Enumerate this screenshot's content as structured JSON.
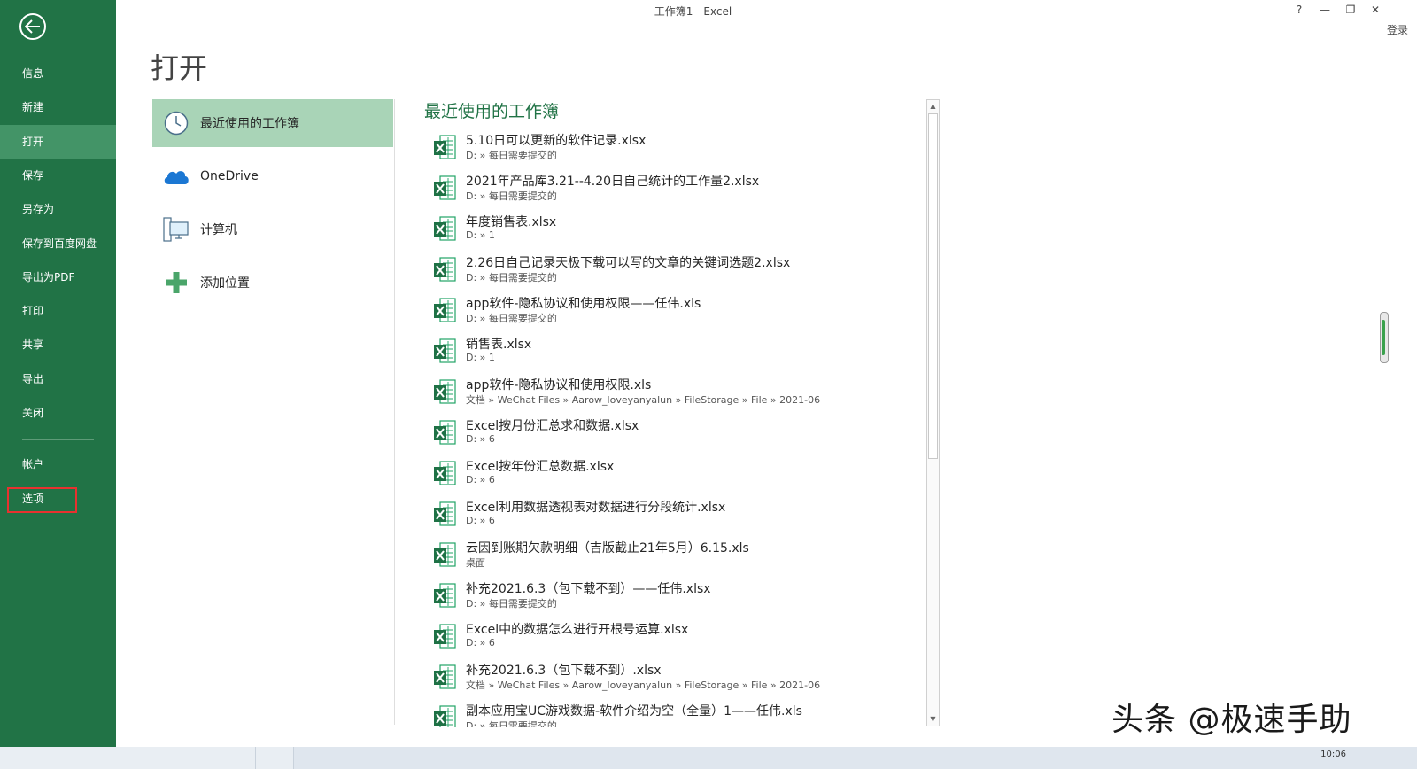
{
  "window": {
    "title": "工作簿1 - Excel",
    "help": "?",
    "minimize": "—",
    "restore": "❐",
    "close": "✕",
    "login": "登录"
  },
  "nav": {
    "items": [
      {
        "label": "信息"
      },
      {
        "label": "新建"
      },
      {
        "label": "打开",
        "active": true
      },
      {
        "label": "保存"
      },
      {
        "label": "另存为"
      },
      {
        "label": "保存到百度网盘"
      },
      {
        "label": "导出为PDF"
      },
      {
        "label": "打印"
      },
      {
        "label": "共享"
      },
      {
        "label": "导出"
      },
      {
        "label": "关闭"
      }
    ],
    "account": "帐户",
    "options": "选项",
    "accent": "#217346",
    "active_color": "#439467",
    "highlight_color": "#e8312f"
  },
  "page": {
    "title": "打开"
  },
  "places": [
    {
      "label": "最近使用的工作簿",
      "icon": "clock-icon",
      "selected": true
    },
    {
      "label": "OneDrive",
      "icon": "cloud-icon"
    },
    {
      "label": "计算机",
      "icon": "computer-icon"
    },
    {
      "label": "添加位置",
      "icon": "plus-icon"
    }
  ],
  "recent": {
    "heading": "最近使用的工作簿",
    "files": [
      {
        "name": "5.10日可以更新的软件记录.xlsx",
        "path": "D: » 每日需要提交的"
      },
      {
        "name": "2021年产品库3.21--4.20日自己统计的工作量2.xlsx",
        "path": "D: » 每日需要提交的"
      },
      {
        "name": "年度销售表.xlsx",
        "path": "D: » 1"
      },
      {
        "name": "2.26日自己记录天极下载可以写的文章的关键词选题2.xlsx",
        "path": "D: » 每日需要提交的"
      },
      {
        "name": "app软件-隐私协议和使用权限——任伟.xls",
        "path": "D: » 每日需要提交的"
      },
      {
        "name": "销售表.xlsx",
        "path": "D: » 1"
      },
      {
        "name": "app软件-隐私协议和使用权限.xls",
        "path": "文档 » WeChat Files » Aarow_loveyanyalun » FileStorage » File » 2021-06"
      },
      {
        "name": "Excel按月份汇总求和数据.xlsx",
        "path": "D: » 6"
      },
      {
        "name": "Excel按年份汇总数据.xlsx",
        "path": "D: » 6"
      },
      {
        "name": "Excel利用数据透视表对数据进行分段统计.xlsx",
        "path": "D: » 6"
      },
      {
        "name": "云因到账期欠款明细（吉版截止21年5月）6.15.xls",
        "path": "桌面"
      },
      {
        "name": "补充2021.6.3（包下载不到）——任伟.xlsx",
        "path": "D: » 每日需要提交的"
      },
      {
        "name": "Excel中的数据怎么进行开根号运算.xlsx",
        "path": "D: » 6"
      },
      {
        "name": "补充2021.6.3（包下载不到）.xlsx",
        "path": "文档 » WeChat Files » Aarow_loveyanyalun » FileStorage » File » 2021-06"
      },
      {
        "name": "副本应用宝UC游戏数据-软件介绍为空（全量）1——任伟.xls",
        "path": "D: » 每日需要提交的"
      }
    ]
  },
  "scrollbar": {
    "up": "▲",
    "down": "▼"
  },
  "watermark": "头条 @极速手助",
  "taskbar": {
    "time": "10:06"
  }
}
